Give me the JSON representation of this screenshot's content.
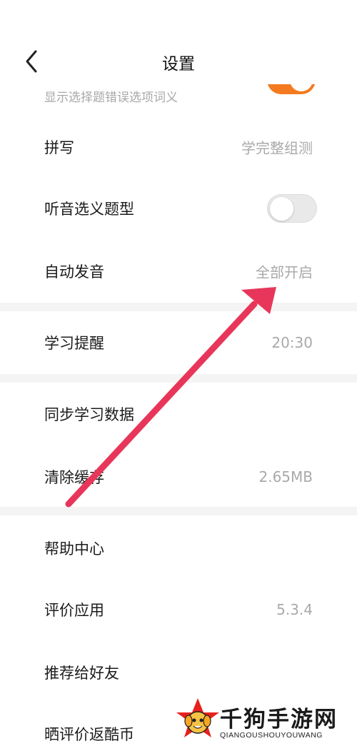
{
  "header": {
    "title": "设置",
    "back_icon": "chevron-left-icon"
  },
  "partial_row": {
    "subtitle": "显示选择题错误选项词义",
    "switch_on": true,
    "accent_color": "#f47a1f"
  },
  "rows": [
    {
      "label": "拼写",
      "value": "学完整组测"
    },
    {
      "label": "听音选义题型",
      "toggle_on": false
    },
    {
      "label": "自动发音",
      "value": "全部开启"
    },
    {
      "label": "学习提醒",
      "value": "20:30"
    },
    {
      "label": "同步学习数据",
      "value": ""
    },
    {
      "label": "清除缓存",
      "value": "2.65MB"
    },
    {
      "label": "帮助中心",
      "value": ""
    },
    {
      "label": "评价应用",
      "value": "5.3.4"
    },
    {
      "label": "推荐给好友",
      "value": ""
    },
    {
      "label": "晒评价返酷币",
      "value": ""
    }
  ],
  "annotation": {
    "color": "#e8365a"
  },
  "watermark": {
    "text": "千狗手游网",
    "sub": "QIANGOUSHOUYOUWANG"
  }
}
